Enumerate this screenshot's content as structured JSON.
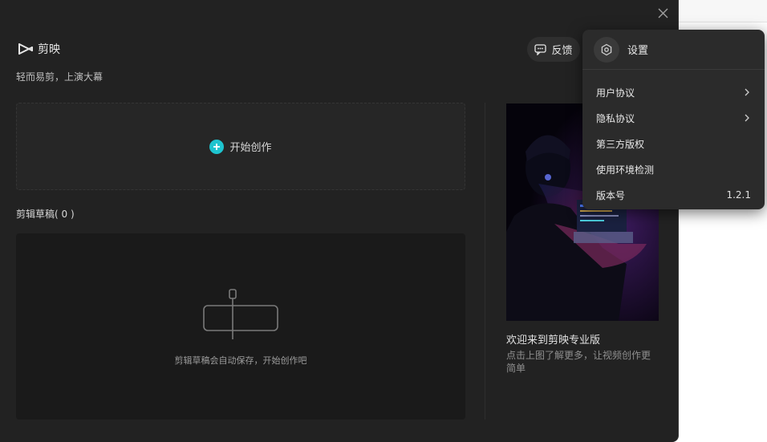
{
  "app": {
    "brand_name": "剪映",
    "tagline": "轻而易剪，上演大幕"
  },
  "header": {
    "feedback_label": "反馈"
  },
  "create": {
    "label": "开始创作"
  },
  "drafts": {
    "title": "剪辑草稿( 0 )",
    "empty_text": "剪辑草稿会自动保存，开始创作吧"
  },
  "promo": {
    "title": "欢迎来到剪映专业版",
    "description": "点击上图了解更多，让视频创作更简单"
  },
  "settings_menu": {
    "header_label": "设置",
    "items": [
      {
        "label": "用户协议",
        "has_submenu": true,
        "value": ""
      },
      {
        "label": "隐私协议",
        "has_submenu": true,
        "value": ""
      },
      {
        "label": "第三方版权",
        "has_submenu": false,
        "value": ""
      },
      {
        "label": "使用环境检测",
        "has_submenu": false,
        "value": ""
      },
      {
        "label": "版本号",
        "has_submenu": false,
        "value": "1.2.1"
      }
    ]
  },
  "colors": {
    "accent": "#1ec4cf",
    "background": "#222222",
    "panel": "#1a1a1a",
    "menu": "#2b2b2b"
  },
  "icons": {
    "close": "close-icon",
    "logo": "capcut-logo-icon",
    "feedback": "feedback-chat-icon",
    "plus": "plus-circle-icon",
    "gear": "gear-icon",
    "chevron": "chevron-right-icon",
    "empty_drafts": "timeline-clip-icon"
  }
}
